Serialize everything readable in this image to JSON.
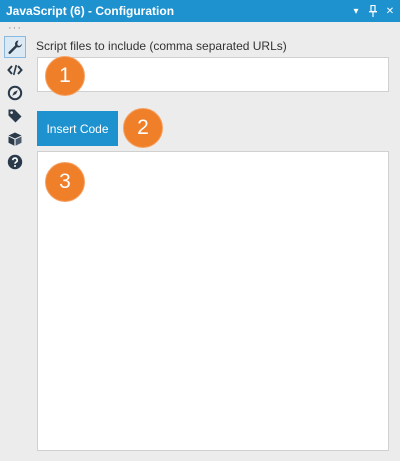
{
  "window": {
    "title": "JavaScript (6) - Configuration",
    "controls": {
      "dropdown_icon": "chevron-down-icon",
      "pin_icon": "pin-icon",
      "close_icon": "close-icon",
      "dropdown_glyph": "▾",
      "close_glyph": "✕"
    }
  },
  "sidebar": {
    "overflow_glyph": "···",
    "items": [
      {
        "icon": "wrench-icon",
        "active": true
      },
      {
        "icon": "code-icon",
        "active": false
      },
      {
        "icon": "compass-icon",
        "active": false
      },
      {
        "icon": "tag-icon",
        "active": false
      },
      {
        "icon": "box-icon",
        "active": false
      },
      {
        "icon": "help-icon",
        "active": false
      }
    ]
  },
  "config": {
    "script_files_label": "Script files to include (comma separated URLs)",
    "script_files_value": "",
    "insert_code_label": "Insert Code",
    "code_value": ""
  },
  "callouts": [
    "1",
    "2",
    "3"
  ],
  "colors": {
    "accent": "#1e92cf",
    "callout": "#f07f2a",
    "background": "#ececec"
  }
}
